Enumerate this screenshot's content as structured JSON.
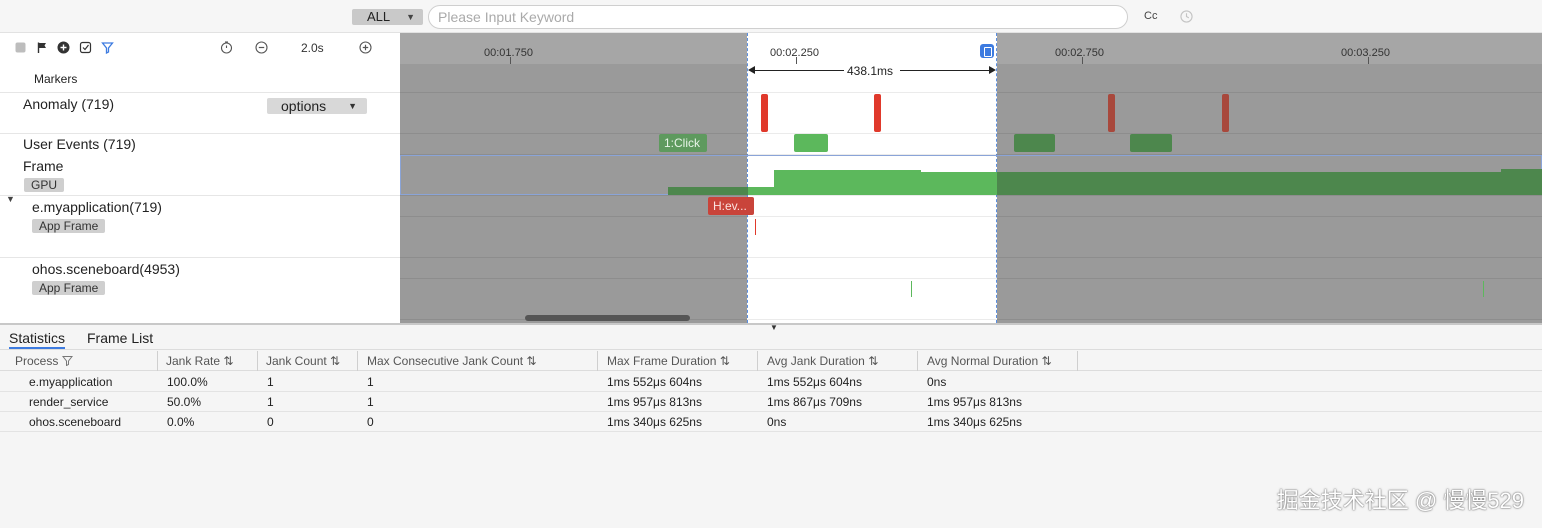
{
  "search": {
    "scope": "ALL",
    "placeholder": "Please Input Keyword",
    "case_label": "Cc"
  },
  "toolbar": {
    "zoom_value": "2.0s"
  },
  "rows": {
    "markers": "Markers",
    "anomaly": "Anomaly (719)",
    "options_label": "options",
    "user_events": "User Events (719)",
    "frame": "Frame",
    "gpu_tag": "GPU",
    "app1": "e.myapplication(719)",
    "app1_tag": "App Frame",
    "app2": "ohos.sceneboard(4953)",
    "app2_tag": "App Frame"
  },
  "timeline": {
    "ticks": [
      "00:01.750",
      "00:02.250",
      "00:02.750",
      "00:03.250"
    ],
    "selection_duration": "438.1ms",
    "click_event": "1:Click",
    "frame_event": "H:ev..."
  },
  "colors": {
    "anomaly_red": "#e0392b",
    "event_green": "#5cb85c",
    "gpu_green": "#5cb85c",
    "selection_border": "#5b8fe0"
  },
  "stats": {
    "tabs": [
      "Statistics",
      "Frame List"
    ],
    "columns": [
      "Process",
      "Jank Rate",
      "Jank Count",
      "Max Consecutive Jank Count",
      "Max Frame Duration",
      "Avg Jank Duration",
      "Avg Normal Duration"
    ],
    "rows": [
      [
        "e.myapplication",
        "100.0%",
        "1",
        "1",
        "1ms 552μs 604ns",
        "1ms 552μs 604ns",
        "0ns"
      ],
      [
        "render_service",
        "50.0%",
        "1",
        "1",
        "1ms 957μs 813ns",
        "1ms 867μs 709ns",
        "1ms 957μs 813ns"
      ],
      [
        "ohos.sceneboard",
        "0.0%",
        "0",
        "0",
        "1ms 340μs 625ns",
        "0ns",
        "1ms 340μs 625ns"
      ]
    ]
  },
  "watermark": "掘金技术社区 @ 慢慢529"
}
